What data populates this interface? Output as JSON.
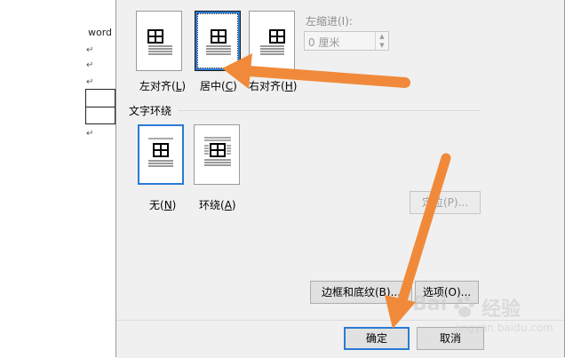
{
  "document": {
    "word_text": "word",
    "para_mark": "↵"
  },
  "alignment": {
    "left_label": "左对齐(",
    "left_key": "L",
    "center_label": "居中(",
    "center_key": "C",
    "right_label": "右对齐(",
    "right_key": "H",
    "close_paren": ")",
    "indent_label": "左缩进(I):",
    "indent_value": "0 厘米"
  },
  "wrap": {
    "section_title": "文字环绕",
    "none_label": "无(",
    "none_key": "N",
    "around_label": "环绕(",
    "around_key": "A",
    "close_paren": ")"
  },
  "buttons": {
    "position": "定位(P)...",
    "borders": "边框和底纹(B)...",
    "options": "选项(O)...",
    "ok": "确定",
    "cancel": "取消"
  },
  "watermark": {
    "brand": "Bai",
    "brand2": "经验",
    "url": "jingyan.baidu.com"
  },
  "colors": {
    "accent": "#2a7bd6",
    "arrow": "#f08a3a"
  }
}
